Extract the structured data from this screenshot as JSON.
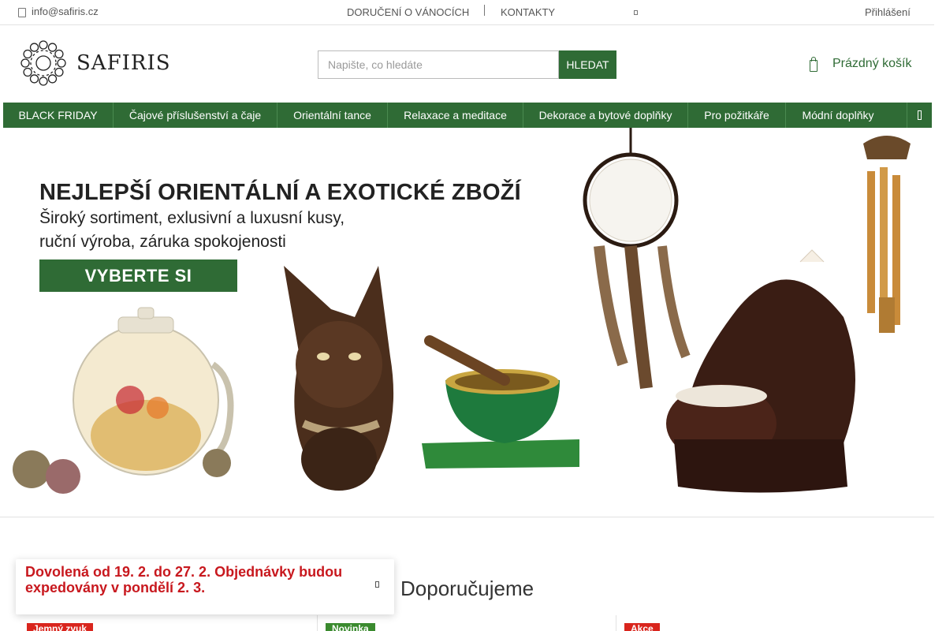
{
  "topbar": {
    "email": "info@safiris.cz",
    "links": [
      "DORUČENÍ O VÁNOCÍCH",
      "KONTAKTY"
    ],
    "login": "Přihlášení"
  },
  "header": {
    "logo_text": "SAFIRIS",
    "search": {
      "placeholder": "Napište, co hledáte",
      "button": "HLEDAT"
    },
    "cart": "Prázdný košík"
  },
  "nav": {
    "items": [
      "BLACK FRIDAY",
      "Čajové příslušenství a čaje",
      "Orientální tance",
      "Relaxace a meditace",
      "Dekorace a bytové doplňky",
      "Pro požitkáře",
      "Módní doplňky"
    ]
  },
  "banner": {
    "headline": "NEJLEPŠÍ ORIENTÁLNÍ A EXOTICKÉ ZBOŽÍ",
    "lines": [
      "Široký sortiment, exlusivní a luxusní kusy,",
      "ruční výroba, záruka spokojenosti"
    ],
    "cta": "VYBERTE SI"
  },
  "notice": {
    "message": "Dovolená od 19. 2. do 27. 2. Objednávky budou expedovány v pondělí 2. 3."
  },
  "section": {
    "title": "Doporučujeme",
    "badges": [
      {
        "label": "Jemný zvuk",
        "color": "#d9251d"
      },
      {
        "label": "Novinka",
        "color": "#3a8a2e"
      },
      {
        "label": "Akce",
        "color": "#d9251d"
      }
    ]
  },
  "colors": {
    "brand_green": "#2f6b35",
    "alert_red": "#c8181e"
  }
}
